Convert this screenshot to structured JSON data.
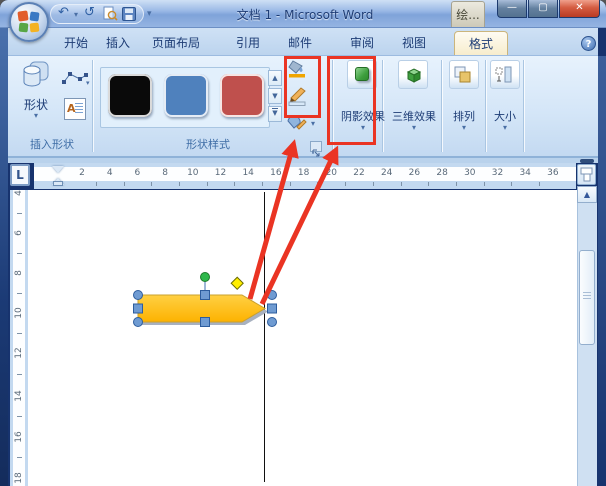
{
  "window": {
    "title": "文档 1 - Microsoft Word",
    "contextual_group_label": "绘...",
    "controls": {
      "minimize": "minimize",
      "restore": "restore",
      "close": "close"
    }
  },
  "qat": {
    "buttons": [
      "undo",
      "redo",
      "print-preview",
      "save"
    ],
    "customize": "▾"
  },
  "tabs": [
    {
      "label": "开始",
      "active": false
    },
    {
      "label": "插入",
      "active": false
    },
    {
      "label": "页面布局",
      "active": false
    },
    {
      "label": "引用",
      "active": false
    },
    {
      "label": "邮件",
      "active": false
    },
    {
      "label": "审阅",
      "active": false
    },
    {
      "label": "视图",
      "active": false
    },
    {
      "label": "格式",
      "active": true
    }
  ],
  "help_icon": "?",
  "ribbon": {
    "insert_shapes": {
      "group_label": "插入形状",
      "shapes_button_label": "形状"
    },
    "shape_styles": {
      "group_label": "形状样式",
      "swatches": [
        "#0a0a0a",
        "#4f81bd",
        "#bf504d"
      ]
    },
    "shadow_effects": {
      "button_label": "阴影效果"
    },
    "three_d_effects": {
      "button_label": "三维效果"
    },
    "arrange": {
      "button_label": "排列"
    },
    "size": {
      "button_label": "大小"
    }
  },
  "ruler": {
    "tab_selector": "L",
    "horizontal_numbers": [
      2,
      4,
      6,
      8,
      10,
      12,
      14,
      16,
      18,
      20,
      22,
      24,
      26,
      28,
      30,
      32,
      34,
      36
    ],
    "vertical_numbers": [
      4,
      6,
      8,
      10,
      12,
      14,
      16,
      18
    ]
  },
  "canvas_shape": {
    "type": "pentagon-right-arrow",
    "fill": "#ffc000",
    "outline": "#c9a02e",
    "shadow": "#a8b1c0",
    "handle_color": "#6f9bd2",
    "rotation_handle_color": "#2eb84b",
    "adjust_handle_color": "#ffee00"
  },
  "annotation": {
    "color": "#ea3423",
    "targets": [
      "fill-and-outline-buttons",
      "shadow-effects-button"
    ]
  }
}
